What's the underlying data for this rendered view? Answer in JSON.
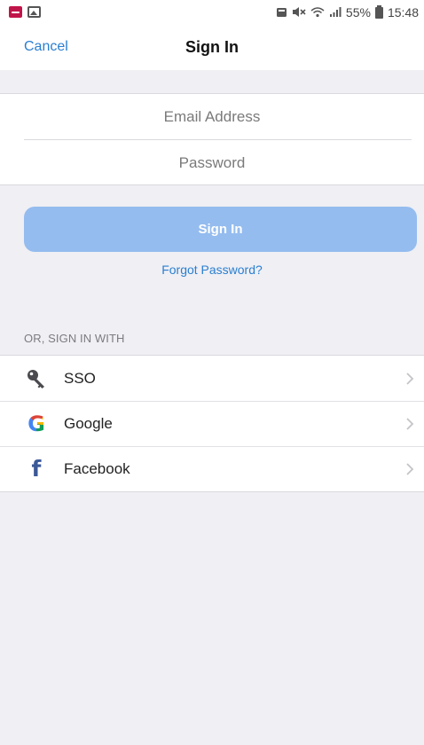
{
  "status_bar": {
    "battery": "55%",
    "time": "15:48"
  },
  "navbar": {
    "cancel_label": "Cancel",
    "title": "Sign In"
  },
  "form": {
    "email_placeholder": "Email Address",
    "email_value": "",
    "password_placeholder": "Password",
    "password_value": ""
  },
  "actions": {
    "signin_label": "Sign In",
    "forgot_label": "Forgot Password?"
  },
  "alt_signin": {
    "section_label": "OR, SIGN IN WITH",
    "providers": [
      {
        "label": "SSO",
        "icon": "key-icon"
      },
      {
        "label": "Google",
        "icon": "google-icon"
      },
      {
        "label": "Facebook",
        "icon": "facebook-icon"
      }
    ]
  },
  "colors": {
    "accent": "#2a7fd0",
    "signin_button_disabled": "#94bcef",
    "background": "#efeff4",
    "facebook": "#3b5998"
  }
}
